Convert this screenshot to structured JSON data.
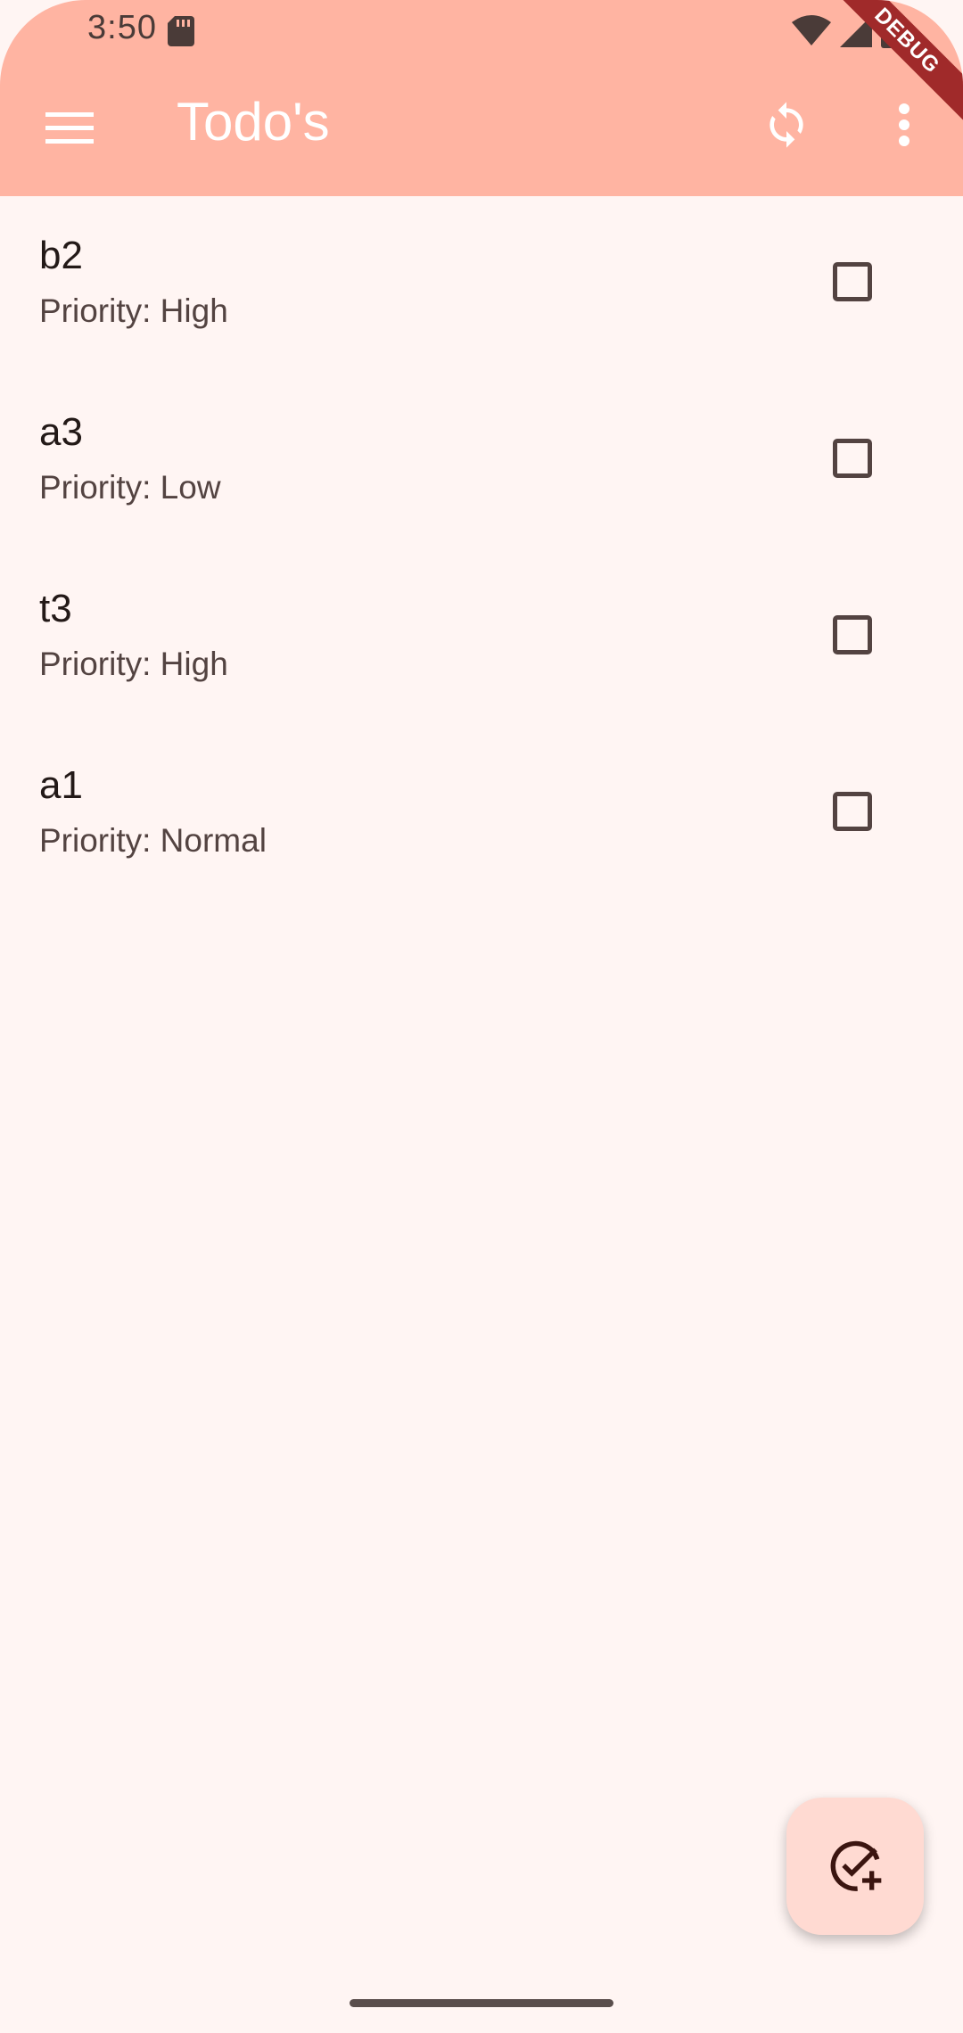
{
  "status_bar": {
    "time": "3:50",
    "icons": [
      "sd-card-icon",
      "wifi-icon",
      "signal-icon",
      "battery-icon"
    ]
  },
  "app_bar": {
    "title": "Todo's",
    "menu_icon": "menu-icon",
    "sync_icon": "sync-icon",
    "more_icon": "more-vert-icon",
    "background": "#ffb4a2"
  },
  "debug_banner": "DEBUG",
  "todos": [
    {
      "title": "b2",
      "priority": "Priority: High",
      "done": false
    },
    {
      "title": "a3",
      "priority": "Priority: Low",
      "done": false
    },
    {
      "title": "t3",
      "priority": "Priority: High",
      "done": false
    },
    {
      "title": "a1",
      "priority": "Priority: Normal",
      "done": false
    }
  ],
  "fab": {
    "icon": "add-task-icon",
    "background": "#ffdad2"
  },
  "colors": {
    "surface": "#fff5f3",
    "primary_container": "#ffb4a2",
    "on_surface": "#231917"
  }
}
